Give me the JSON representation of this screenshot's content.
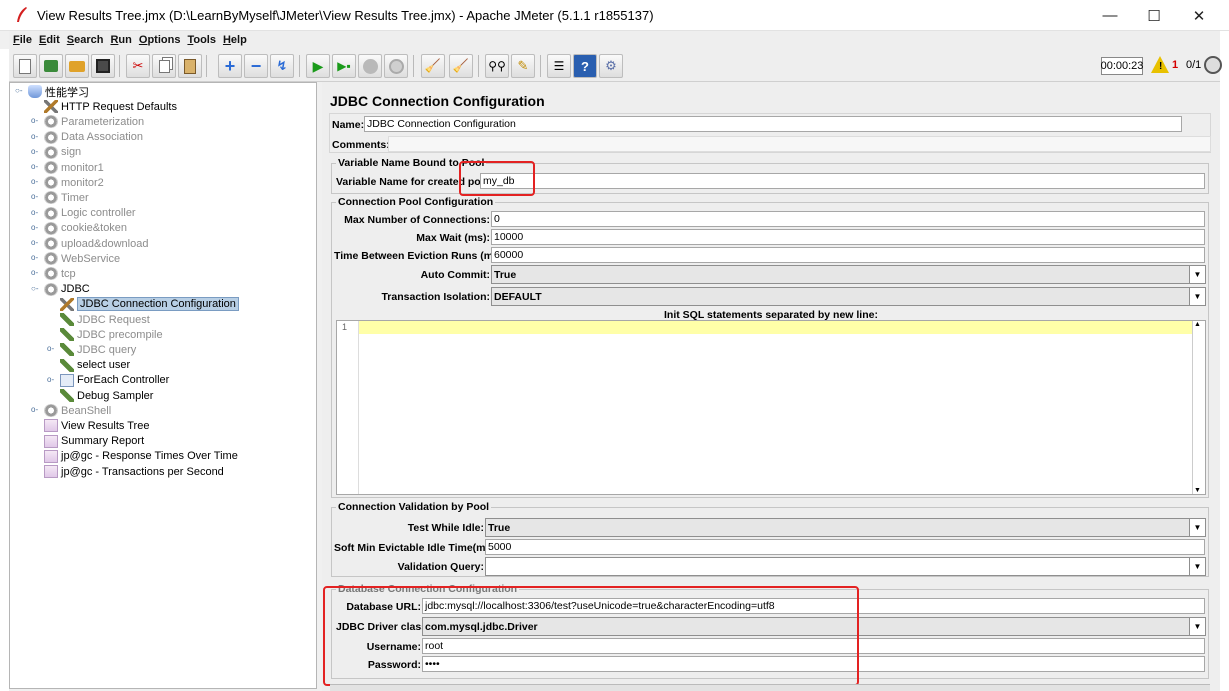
{
  "window": {
    "title": "View Results Tree.jmx (D:\\LearnByMyself\\JMeter\\View Results Tree.jmx) - Apache JMeter (5.1.1 r1855137)",
    "minimize": "—",
    "maximize": "☐",
    "close": "✕"
  },
  "menu": [
    {
      "key": "F",
      "rest": "ile"
    },
    {
      "key": "E",
      "rest": "dit"
    },
    {
      "key": "S",
      "rest": "earch"
    },
    {
      "key": "R",
      "rest": "un"
    },
    {
      "key": "O",
      "rest": "ptions"
    },
    {
      "key": "T",
      "rest": "ools"
    },
    {
      "key": "H",
      "rest": "elp"
    }
  ],
  "toolbar": {
    "icons": [
      "new-icon",
      "templates-icon",
      "open-icon",
      "save-icon",
      "cut-icon",
      "copy-icon",
      "paste-icon",
      "expand-icon",
      "collapse-icon",
      "toggle-icon",
      "start-icon",
      "start-no-pause-icon",
      "stop-icon",
      "shutdown-icon",
      "clear-icon",
      "clear-all-icon",
      "search-icon",
      "reset-search-icon",
      "function-helper-icon",
      "help-icon",
      "remote-icon"
    ],
    "timer": "00:00:23",
    "error_count": "1",
    "threads": "0/1"
  },
  "tree": [
    {
      "label": "性能学习",
      "icon": "flask-icon",
      "level": 0,
      "disabled": false,
      "selected": false,
      "expander": "open"
    },
    {
      "label": "HTTP Request Defaults",
      "icon": "tools-icon",
      "level": 1,
      "disabled": false,
      "selected": false,
      "expander": ""
    },
    {
      "label": "Parameterization",
      "icon": "gear-icon",
      "level": 1,
      "disabled": true,
      "selected": false,
      "expander": "closed"
    },
    {
      "label": "Data Association",
      "icon": "gear-icon",
      "level": 1,
      "disabled": true,
      "selected": false,
      "expander": "closed"
    },
    {
      "label": "sign",
      "icon": "gear-icon",
      "level": 1,
      "disabled": true,
      "selected": false,
      "expander": "closed"
    },
    {
      "label": "monitor1",
      "icon": "gear-icon",
      "level": 1,
      "disabled": true,
      "selected": false,
      "expander": "closed"
    },
    {
      "label": "monitor2",
      "icon": "gear-icon",
      "level": 1,
      "disabled": true,
      "selected": false,
      "expander": "closed"
    },
    {
      "label": "Timer",
      "icon": "gear-icon",
      "level": 1,
      "disabled": true,
      "selected": false,
      "expander": "closed"
    },
    {
      "label": "Logic controller",
      "icon": "gear-icon",
      "level": 1,
      "disabled": true,
      "selected": false,
      "expander": "closed"
    },
    {
      "label": "cookie&token",
      "icon": "gear-icon",
      "level": 1,
      "disabled": true,
      "selected": false,
      "expander": "closed"
    },
    {
      "label": "upload&download",
      "icon": "gear-icon",
      "level": 1,
      "disabled": true,
      "selected": false,
      "expander": "closed"
    },
    {
      "label": "WebService",
      "icon": "gear-icon",
      "level": 1,
      "disabled": true,
      "selected": false,
      "expander": "closed"
    },
    {
      "label": "tcp",
      "icon": "gear-icon",
      "level": 1,
      "disabled": true,
      "selected": false,
      "expander": "closed"
    },
    {
      "label": "JDBC",
      "icon": "gear-icon",
      "level": 1,
      "disabled": false,
      "selected": false,
      "expander": "open"
    },
    {
      "label": "JDBC Connection Configuration",
      "icon": "tools-icon",
      "level": 2,
      "disabled": false,
      "selected": true,
      "expander": ""
    },
    {
      "label": "JDBC Request",
      "icon": "pipette-icon",
      "level": 2,
      "disabled": true,
      "selected": false,
      "expander": ""
    },
    {
      "label": "JDBC precompile",
      "icon": "pipette-icon",
      "level": 2,
      "disabled": true,
      "selected": false,
      "expander": ""
    },
    {
      "label": "JDBC query",
      "icon": "pipette-icon",
      "level": 2,
      "disabled": true,
      "selected": false,
      "expander": "closed"
    },
    {
      "label": "select user",
      "icon": "pipette-icon",
      "level": 2,
      "disabled": false,
      "selected": false,
      "expander": ""
    },
    {
      "label": "ForEach Controller",
      "icon": "loop-icon",
      "level": 2,
      "disabled": false,
      "selected": false,
      "expander": "closed"
    },
    {
      "label": "Debug Sampler",
      "icon": "pipette-icon",
      "level": 2,
      "disabled": false,
      "selected": false,
      "expander": ""
    },
    {
      "label": "BeanShell",
      "icon": "gear-icon",
      "level": 1,
      "disabled": true,
      "selected": false,
      "expander": "closed"
    },
    {
      "label": "View Results Tree",
      "icon": "graph-icon",
      "level": 1,
      "disabled": false,
      "selected": false,
      "expander": ""
    },
    {
      "label": "Summary Report",
      "icon": "graph-icon",
      "level": 1,
      "disabled": false,
      "selected": false,
      "expander": ""
    },
    {
      "label": "jp@gc - Response Times Over Time",
      "icon": "graph-icon",
      "level": 1,
      "disabled": false,
      "selected": false,
      "expander": ""
    },
    {
      "label": "jp@gc - Transactions per Second",
      "icon": "graph-icon",
      "level": 1,
      "disabled": false,
      "selected": false,
      "expander": ""
    }
  ],
  "panel": {
    "title": "JDBC Connection Configuration",
    "name_label": "Name:",
    "name_value": "JDBC Connection Configuration",
    "comments_label": "Comments:",
    "comments_value": "",
    "variable_group": {
      "title": "Variable Name Bound to Pool",
      "label": "Variable Name for created pool:",
      "value": "my_db"
    },
    "pool_group": {
      "title": "Connection Pool Configuration",
      "max_connections_label": "Max Number of Connections:",
      "max_connections_value": "0",
      "max_wait_label": "Max Wait (ms):",
      "max_wait_value": "10000",
      "eviction_label": "Time Between Eviction Runs (ms):",
      "eviction_value": "60000",
      "auto_commit_label": "Auto Commit:",
      "auto_commit_value": "True",
      "isolation_label": "Transaction Isolation:",
      "isolation_value": "DEFAULT",
      "init_sql_label": "Init SQL statements separated by new line:",
      "line_number": "1"
    },
    "validation_group": {
      "title": "Connection Validation by Pool",
      "test_idle_label": "Test While Idle:",
      "test_idle_value": "True",
      "soft_min_label": "Soft Min Evictable Idle Time(ms):",
      "soft_min_value": "5000",
      "query_label": "Validation Query:",
      "query_value": ""
    },
    "database_group": {
      "title": "Database Connection Configuration",
      "url_label": "Database URL:",
      "url_value": "jdbc:mysql://localhost:3306/test?useUnicode=true&characterEncoding=utf8",
      "driver_label": "JDBC Driver class:",
      "driver_value": "com.mysql.jdbc.Driver",
      "username_label": "Username:",
      "username_value": "root",
      "password_label": "Password:",
      "password_value": "••••"
    }
  },
  "colors": {
    "highlight_box": "#e32222",
    "selected_bg": "#b8cfe5",
    "disabled_text": "#8c8c8c",
    "sql_current_line": "#ffffa8"
  }
}
